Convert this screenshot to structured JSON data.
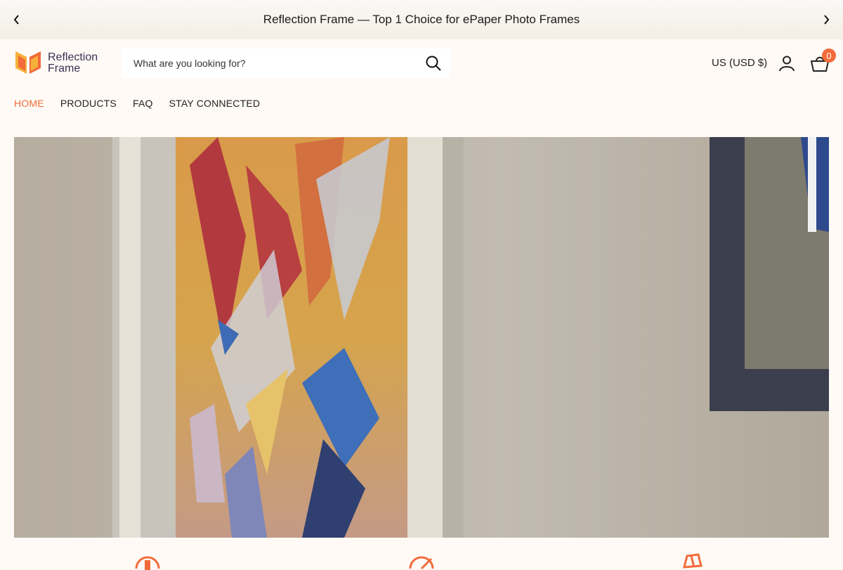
{
  "announcement": {
    "text": "Reflection Frame — Top 1 Choice for ePaper Photo Frames"
  },
  "logo": {
    "line1": "Reflection",
    "line2": "Frame"
  },
  "search": {
    "placeholder": "What are you looking for?"
  },
  "header": {
    "currency": "US (USD $)",
    "cart_count": "0"
  },
  "nav": {
    "items": [
      "HOME",
      "PRODUCTS",
      "FAQ",
      "STAY CONNECTED"
    ],
    "active": "HOME"
  },
  "colors": {
    "accent": "#f26b3a",
    "background": "#fffaf6"
  },
  "icons": {
    "prev": "chevron-left-icon",
    "next": "chevron-right-icon",
    "search": "search-icon",
    "account": "user-icon",
    "cart": "cart-icon"
  }
}
